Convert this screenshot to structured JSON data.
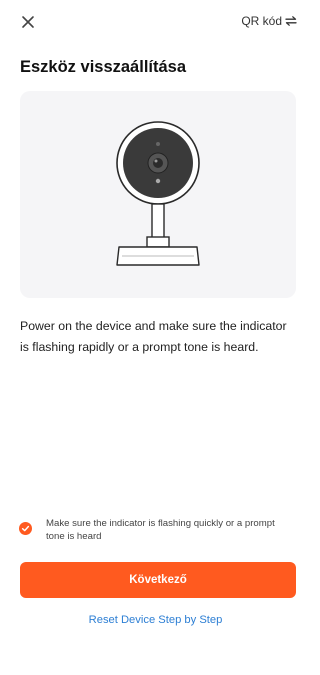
{
  "header": {
    "close_icon": "close-icon",
    "qr_label": "QR kód",
    "qr_icon": "swap-arrows-icon"
  },
  "page": {
    "title": "Eszköz visszaállítása"
  },
  "illustration": {
    "icon": "camera-device-illustration"
  },
  "instructions": {
    "text": "Power on the device and make sure the indicator is flashing rapidly or a prompt tone is heard."
  },
  "confirmation": {
    "checked": true,
    "text": "Make sure the indicator is flashing quickly or a prompt tone is heard"
  },
  "actions": {
    "next_label": "Következő",
    "reset_label": "Reset Device Step by Step"
  },
  "colors": {
    "accent": "#ff5a1f",
    "link": "#2d7fd4",
    "illustration_bg": "#f5f5f7"
  }
}
